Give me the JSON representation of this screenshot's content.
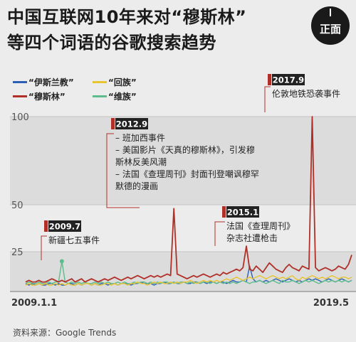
{
  "title": {
    "line1": "中国互联网10年来对“穆斯林”",
    "line2": "等四个词语的谷歌搜索趋势"
  },
  "logo": {
    "text": "正面",
    "icon": "logo-seal-icon"
  },
  "colors": {
    "background": "#ececec",
    "band": "#dcdcdc",
    "grid": "#c8c8c8",
    "blue": "#2c5fb3",
    "red": "#b03028",
    "yellow": "#e8c430",
    "green": "#5cbc8c",
    "annotation": "#b03028",
    "tag_bg": "#222222",
    "tag_fg": "#ffffff"
  },
  "source": "资料来源：Google Trends",
  "chart_data": {
    "type": "line",
    "x_labels": {
      "start": "2009.1.1",
      "end": "2019.5"
    },
    "y_ticks": [
      25,
      50,
      100
    ],
    "ylim": [
      0,
      100
    ],
    "grid": true,
    "legend_placement": "top-left",
    "series": [
      {
        "name": "“伊斯兰教”",
        "color": "#2c5fb3",
        "values": [
          5,
          4,
          5,
          4,
          5,
          4,
          4,
          5,
          5,
          4,
          5,
          4,
          4,
          5,
          5,
          4,
          5,
          4,
          5,
          5,
          4,
          5,
          4,
          5,
          5,
          4,
          5,
          5,
          4,
          5,
          5,
          5,
          4,
          5,
          5,
          6,
          5,
          5,
          5,
          4,
          5,
          5,
          6,
          5,
          5,
          6,
          5,
          5,
          6,
          5,
          5,
          6,
          6,
          5,
          6,
          5,
          6,
          6,
          5,
          6,
          6,
          5,
          6,
          7,
          6,
          6,
          7,
          6,
          16,
          8,
          6,
          7,
          6,
          7,
          6,
          7,
          8,
          7,
          6,
          7,
          8,
          7,
          6,
          7,
          6,
          7,
          8,
          7,
          8,
          7,
          6,
          7,
          8,
          7,
          6,
          7,
          8,
          7,
          6,
          7
        ]
      },
      {
        "name": "“回族”",
        "color": "#e8c430",
        "values": [
          4,
          5,
          4,
          4,
          5,
          4,
          5,
          4,
          4,
          5,
          4,
          5,
          4,
          5,
          4,
          4,
          5,
          4,
          5,
          5,
          4,
          5,
          4,
          4,
          5,
          5,
          4,
          5,
          4,
          5,
          5,
          4,
          5,
          5,
          6,
          5,
          5,
          4,
          5,
          6,
          5,
          6,
          5,
          5,
          6,
          5,
          6,
          5,
          6,
          6,
          7,
          6,
          5,
          6,
          7,
          6,
          7,
          6,
          7,
          6,
          7,
          8,
          7,
          8,
          9,
          8,
          7,
          8,
          9,
          8,
          9,
          10,
          9,
          8,
          9,
          10,
          9,
          8,
          9,
          8,
          9,
          10,
          8,
          7,
          9,
          8,
          9,
          10,
          9,
          8,
          9,
          8,
          9,
          10,
          9,
          8,
          9,
          9,
          8,
          9
        ]
      },
      {
        "name": "“穆斯林”",
        "color": "#b03028",
        "values": [
          6,
          7,
          6,
          6,
          7,
          6,
          6,
          7,
          8,
          7,
          6,
          7,
          6,
          7,
          8,
          6,
          7,
          8,
          6,
          7,
          8,
          7,
          6,
          7,
          8,
          7,
          8,
          9,
          8,
          7,
          8,
          9,
          8,
          9,
          10,
          9,
          8,
          9,
          10,
          9,
          10,
          9,
          10,
          11,
          10,
          48,
          11,
          10,
          9,
          8,
          9,
          10,
          9,
          10,
          11,
          10,
          9,
          10,
          11,
          10,
          12,
          11,
          12,
          13,
          14,
          13,
          15,
          28,
          14,
          13,
          16,
          14,
          12,
          15,
          18,
          16,
          14,
          13,
          12,
          15,
          17,
          15,
          14,
          13,
          16,
          15,
          14,
          100,
          15,
          13,
          14,
          15,
          14,
          13,
          14,
          16,
          15,
          14,
          17,
          23
        ]
      },
      {
        "name": "“维族”",
        "color": "#5cbc8c",
        "values": [
          5,
          6,
          5,
          5,
          6,
          5,
          5,
          6,
          5,
          6,
          6,
          19,
          6,
          5,
          6,
          5,
          6,
          5,
          6,
          5,
          5,
          6,
          5,
          6,
          5,
          6,
          5,
          5,
          6,
          5,
          6,
          5,
          5,
          6,
          5,
          6,
          6,
          5,
          6,
          5,
          6,
          5,
          6,
          6,
          5,
          6,
          5,
          6,
          6,
          5,
          6,
          5,
          6,
          5,
          6,
          6,
          5,
          6,
          5,
          6,
          5,
          6,
          5,
          6,
          5,
          6,
          7,
          6,
          5,
          6,
          6,
          7,
          6,
          5,
          6,
          7,
          6,
          5,
          7,
          6,
          6,
          7,
          6,
          5,
          6,
          7,
          6,
          7,
          6,
          5,
          6,
          7,
          6,
          7,
          6,
          7,
          6,
          7,
          6,
          7
        ]
      }
    ],
    "annotations": [
      {
        "tag": "2009.7",
        "text": [
          "新疆七五事件"
        ]
      },
      {
        "tag": "2012.9",
        "text": [
          "– 班加西事件",
          "– 美国影片《天真的穆斯林》，引发穆",
          "斯林反美风潮",
          "– 法国《查理周刊》封面刊登嘲讽穆罕",
          "默德的漫画"
        ]
      },
      {
        "tag": "2015.1",
        "text": [
          "法国《查理周刊》",
          "杂志社遭枪击"
        ]
      },
      {
        "tag": "2017.9",
        "text": [
          "伦敦地铁恐袭事件"
        ]
      }
    ]
  }
}
